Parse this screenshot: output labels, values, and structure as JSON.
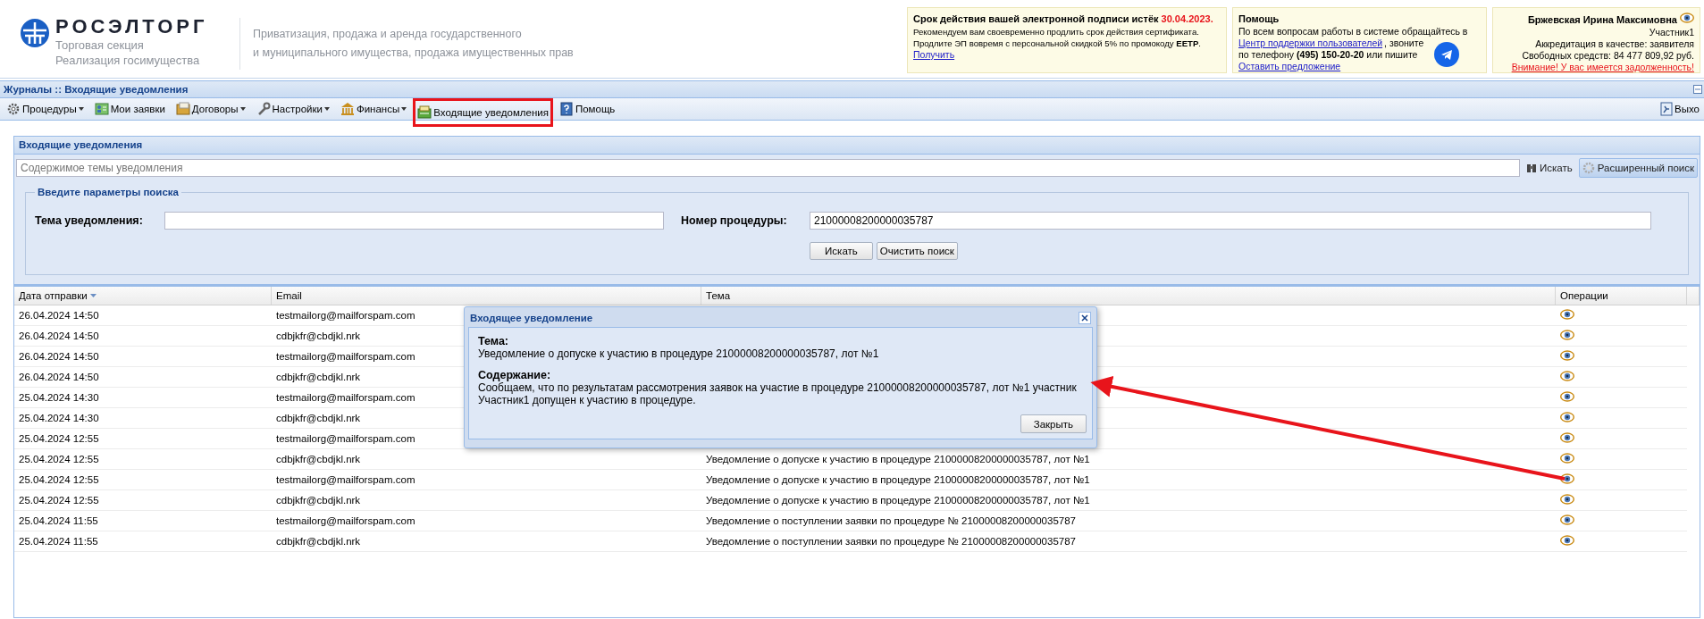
{
  "header": {
    "brand": "РОСЭЛТОРГ",
    "subtitle": [
      "Торговая секция",
      "Реализация госимущества"
    ],
    "tagline": [
      "Приватизация, продажа и аренда государственного",
      "и муниципального имущества, продажа имущественных прав"
    ]
  },
  "signature_notice": {
    "title": "Срок действия вашей электронной подписи истёк",
    "date": "30.04.2023.",
    "lines": [
      "Рекомендуем вам своевременно продлить срок действия сертификата.",
      "Продлите ЭП вовремя с персональной скидкой 5% по промокоду **EETP**."
    ],
    "link": "Получить"
  },
  "help": {
    "title": "Помощь",
    "line1": "По всем вопросам работы в системе обращайтесь в",
    "support_link": "Центр поддержки пользователей",
    "line2_rest": ", звоните",
    "line3": "по телефону **(495) 150-20-20** или пишите",
    "suggest_link": "Оставить предложение"
  },
  "user": {
    "name": "Бржевская Ирина Максимовна",
    "role": "Участник1",
    "accreditation": "Аккредитация в качестве: заявителя",
    "funds": "Свободных средств: 84 477 809,92 руб.",
    "warning": "Внимание! У вас имеется задолженность!"
  },
  "breadcrumb": "Журналы :: Входящие уведомления",
  "toolbar": [
    {
      "label": "Процедуры",
      "has_menu": true,
      "highlighted": false
    },
    {
      "label": "Мои заявки",
      "has_menu": false,
      "highlighted": false
    },
    {
      "label": "Договоры",
      "has_menu": true,
      "highlighted": false
    },
    {
      "label": "Настройки",
      "has_menu": true,
      "highlighted": false
    },
    {
      "label": "Финансы",
      "has_menu": true,
      "highlighted": false
    },
    {
      "label": "Входящие уведомления",
      "has_menu": false,
      "highlighted": true
    },
    {
      "label": "Помощь",
      "has_menu": false,
      "highlighted": false
    }
  ],
  "exit": "Выхо",
  "panel": {
    "title": "Входящие уведомления",
    "quick_search": {
      "placeholder": "Содержимое темы уведомления"
    },
    "search_button": "Искать",
    "advanced_button": {
      "label": "Расширенный поиск",
      "selected": true
    }
  },
  "filters": {
    "legend": "Введите параметры поиска",
    "fields": [
      {
        "label": "Тема уведомления:"
      },
      {
        "label": "Номер процедуры:",
        "value": "21000008200000035787"
      }
    ],
    "buttons": [
      "Искать",
      "Очистить поиск"
    ]
  },
  "table": {
    "columns": [
      {
        "label": "Дата отправки",
        "sorted": true
      },
      {
        "label": "Email",
        "sorted": false
      },
      {
        "label": "Тема",
        "sorted": false
      },
      {
        "label": "Операции",
        "sorted": false
      }
    ],
    "rows": [
      {
        "date": "26.04.2024 14:50",
        "email": "testmailorg@mailforspam.com"
      },
      {
        "date": "26.04.2024 14:50",
        "email": "cdbjkfr@cbdjkl.nrk"
      },
      {
        "date": "26.04.2024 14:50",
        "email": "testmailorg@mailforspam.com"
      },
      {
        "date": "26.04.2024 14:50",
        "email": "cdbjkfr@cbdjkl.nrk"
      },
      {
        "date": "25.04.2024 14:30",
        "email": "testmailorg@mailforspam.com"
      },
      {
        "date": "25.04.2024 14:30",
        "email": "cdbjkfr@cbdjkl.nrk"
      },
      {
        "date": "25.04.2024 12:55",
        "email": "testmailorg@mailforspam.com"
      },
      {
        "date": "25.04.2024 12:55",
        "email": "cdbjkfr@cbdjkl.nrk",
        "subject": "Уведомление о допуске к участию в процедуре 21000008200000035787, лот №1"
      },
      {
        "date": "25.04.2024 12:55",
        "email": "testmailorg@mailforspam.com",
        "subject": "Уведомление о допуске к участию в процедуре 21000008200000035787, лот №1"
      },
      {
        "date": "25.04.2024 12:55",
        "email": "cdbjkfr@cbdjkl.nrk",
        "subject": "Уведомление о допуске к участию в процедуре 21000008200000035787, лот №1"
      },
      {
        "date": "25.04.2024 11:55",
        "email": "testmailorg@mailforspam.com",
        "subject": "Уведомление о поступлении заявки по процедуре № 21000008200000035787"
      },
      {
        "date": "25.04.2024 11:55",
        "email": "cdbjkfr@cbdjkl.nrk",
        "subject": "Уведомление о поступлении заявки по процедуре № 21000008200000035787"
      }
    ]
  },
  "dialog": {
    "title": "Входящее уведомление",
    "subject_label": "Тема:",
    "subject": "Уведомление о допуске к участию в процедуре 21000008200000035787, лот №1",
    "content_label": "Содержание:",
    "content": "Сообщаем, что по результатам рассмотрения заявок на участие в процедуре 21000008200000035787, лот №1 участник Участник1 допущен к участию в процедуре.",
    "close_button": "Закрыть"
  }
}
